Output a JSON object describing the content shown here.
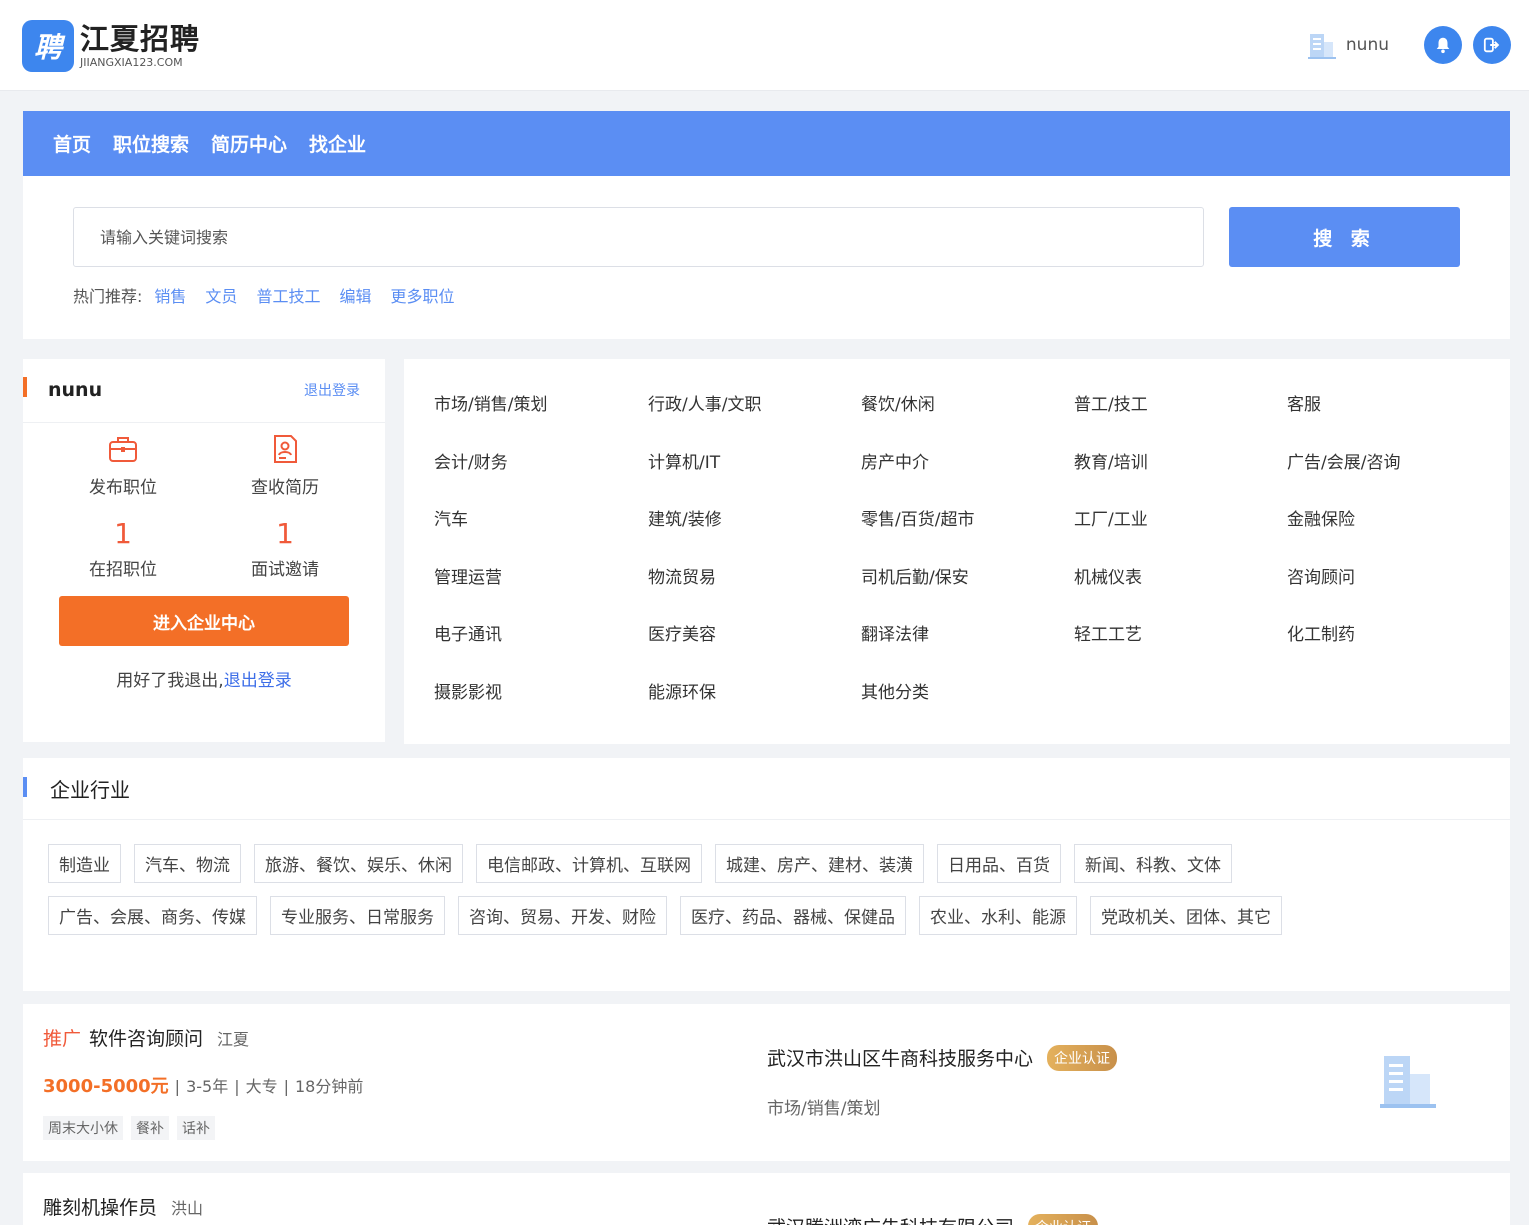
{
  "header": {
    "logo_glyph": "聘",
    "logo_name": "江夏招聘",
    "logo_domain": "JIIANGXIA123.COM",
    "username": "nunu"
  },
  "nav": {
    "items": [
      "首页",
      "职位搜索",
      "简历中心",
      "找企业"
    ]
  },
  "search": {
    "placeholder": "请输入关键词搜索",
    "button": "搜 索",
    "hot_label": "热门推荐:",
    "hot_links": [
      "销售",
      "文员",
      "普工技工",
      "编辑",
      "更多职位"
    ]
  },
  "user_card": {
    "name": "nunu",
    "logout_small": "退出登录",
    "post_job": "发布职位",
    "check_resume": "查收简历",
    "active_jobs_count": "1",
    "active_jobs_label": "在招职位",
    "interviews_count": "1",
    "interviews_label": "面试邀请",
    "enter_button": "进入企业中心",
    "foot_text": "用好了我退出,",
    "foot_link": "退出登录"
  },
  "categories": [
    [
      "市场/销售/策划",
      "行政/人事/文职",
      "餐饮/休闲",
      "普工/技工",
      "客服"
    ],
    [
      "会计/财务",
      "计算机/IT",
      "房产中介",
      "教育/培训",
      "广告/会展/咨询"
    ],
    [
      "汽车",
      "建筑/装修",
      "零售/百货/超市",
      "工厂/工业",
      "金融保险"
    ],
    [
      "管理运营",
      "物流贸易",
      "司机后勤/保安",
      "机械仪表",
      "咨询顾问"
    ],
    [
      "电子通讯",
      "医疗美容",
      "翻译法律",
      "轻工工艺",
      "化工制药"
    ],
    [
      "摄影影视",
      "能源环保",
      "其他分类"
    ]
  ],
  "industries": {
    "title": "企业行业",
    "row1": [
      "制造业",
      "汽车、物流",
      "旅游、餐饮、娱乐、休闲",
      "电信邮政、计算机、互联网",
      "城建、房产、建材、装潢",
      "日用品、百货",
      "新闻、科教、文体"
    ],
    "row2": [
      "广告、会展、商务、传媒",
      "专业服务、日常服务",
      "咨询、贸易、开发、财险",
      "医疗、药品、器械、保健品",
      "农业、水利、能源",
      "党政机关、团体、其它"
    ]
  },
  "jobs": [
    {
      "promo": "推广",
      "title": "软件咨询顾问",
      "location": "江夏",
      "salary": "3000-5000元",
      "experience": "3-5年",
      "education": "大专",
      "time": "18分钟前",
      "welfare": [
        "周末大小休",
        "餐补",
        "话补"
      ],
      "company": "武汉市洪山区牛商科技服务中心",
      "badge": "企业认证",
      "industry": "市场/销售/策划"
    },
    {
      "title": "雕刻机操作员",
      "location": "洪山",
      "company": "武汉腾洲湾广告科技有限公司",
      "badge": "企业认证"
    }
  ],
  "colors": {
    "primary": "#5b8ef3",
    "accent_orange": "#f36f27",
    "count_red": "#f05a3a"
  }
}
